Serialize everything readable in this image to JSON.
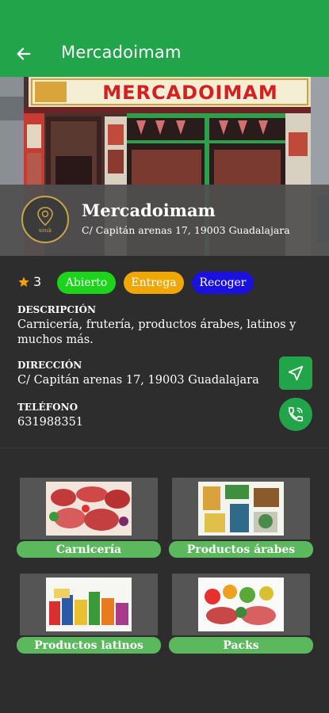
{
  "header": {
    "title": "Mercadoimam",
    "back_icon": "arrow-left-icon"
  },
  "hero": {
    "sign_text": "MERCADOIMAM"
  },
  "store": {
    "name": "Mercadoimam",
    "address": "C/ Capitán arenas 17, 19003 Guadalajara",
    "logo_text": "souk"
  },
  "rating": {
    "value": "3",
    "icon": "star-icon"
  },
  "chips": {
    "open": "Abierto",
    "delivery": "Entrega",
    "pickup": "Recoger"
  },
  "description": {
    "label": "DESCRIPCIÓN",
    "line1": "Carnicería, frutería, productos árabes, latinos y",
    "line2": "muchos más."
  },
  "address_section": {
    "label": "DIRECCIÓN",
    "value": "C/ Capitán arenas 17, 19003 Guadalajara"
  },
  "phone_section": {
    "label": "TELÉFONO",
    "value": "631988351"
  },
  "categories": [
    {
      "label": "Carnicería"
    },
    {
      "label": "Productos árabes"
    },
    {
      "label": "Productos latinos"
    },
    {
      "label": "Packs"
    }
  ],
  "colors": {
    "app_bar": "#22a54a",
    "background": "#2d2d2d",
    "chip_open": "#1dd41d",
    "chip_delivery": "#f0a800",
    "chip_pickup": "#1a10e0",
    "category_label": "#5cb85c"
  }
}
